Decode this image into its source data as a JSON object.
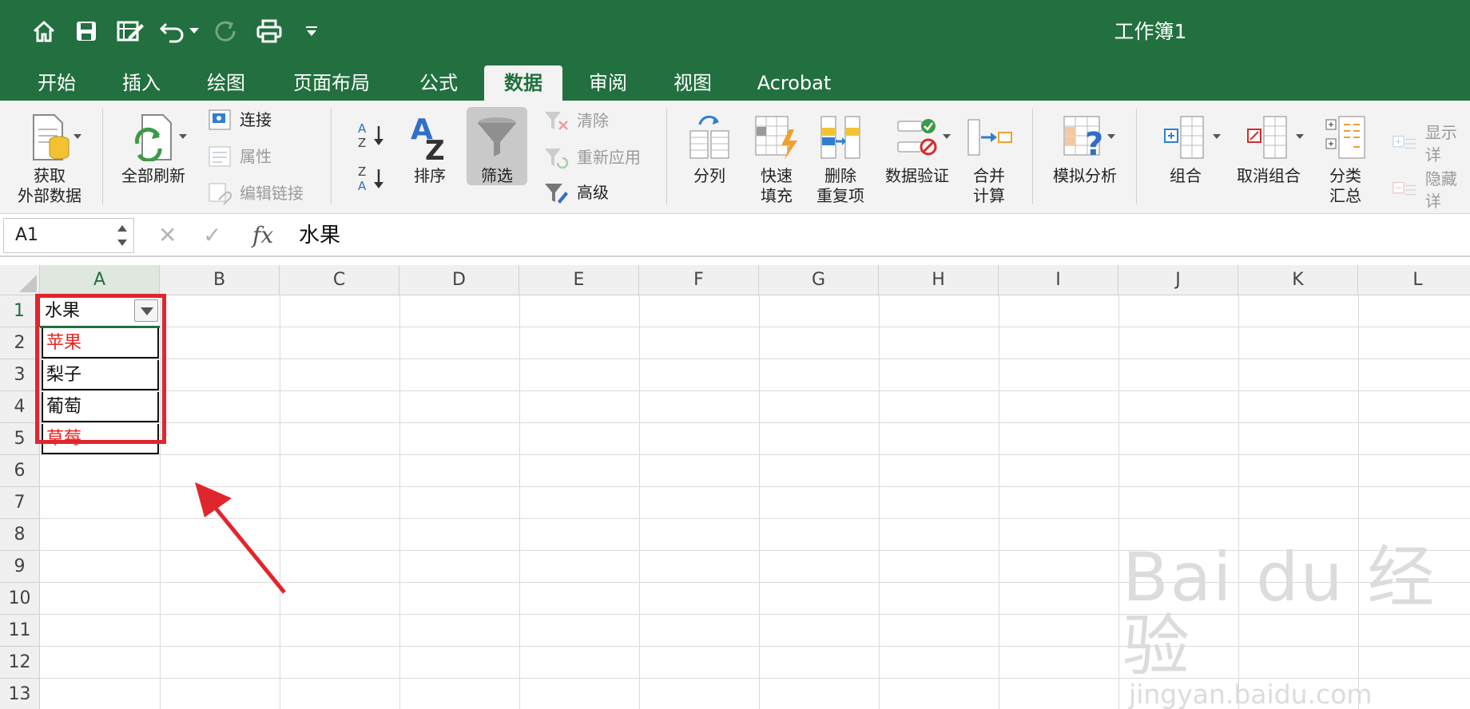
{
  "window": {
    "title": "工作簿1"
  },
  "tabs": [
    {
      "label": "开始"
    },
    {
      "label": "插入"
    },
    {
      "label": "绘图"
    },
    {
      "label": "页面布局"
    },
    {
      "label": "公式"
    },
    {
      "label": "数据"
    },
    {
      "label": "审阅"
    },
    {
      "label": "视图"
    },
    {
      "label": "Acrobat"
    }
  ],
  "active_tab": "数据",
  "ribbon": {
    "get_external_line1": "获取",
    "get_external_line2": "外部数据",
    "refresh_all": "全部刷新",
    "connections": "连接",
    "properties": "属性",
    "edit_links": "编辑链接",
    "sort": "排序",
    "filter": "筛选",
    "clear": "清除",
    "reapply": "重新应用",
    "advanced": "高级",
    "text_to_columns": "分列",
    "flash_fill_line1": "快速",
    "flash_fill_line2": "填充",
    "remove_dup_line1": "删除",
    "remove_dup_line2": "重复项",
    "data_validation": "数据验证",
    "consolidate_line1": "合并",
    "consolidate_line2": "计算",
    "what_if": "模拟分析",
    "group": "组合",
    "ungroup": "取消组合",
    "subtotal_line1": "分类",
    "subtotal_line2": "汇总",
    "show_detail": "显示详",
    "hide_detail": "隐藏详"
  },
  "formula_bar": {
    "name_box": "A1",
    "fx": "fx",
    "value": "水果"
  },
  "sheet": {
    "columns": [
      "A",
      "B",
      "C",
      "D",
      "E",
      "F",
      "G",
      "H",
      "I",
      "J",
      "K",
      "L"
    ],
    "rows": [
      "1",
      "2",
      "3",
      "4",
      "5",
      "6",
      "7",
      "8",
      "9",
      "10",
      "11",
      "12",
      "13"
    ],
    "cells_a": [
      "水果",
      "苹果",
      "梨子",
      "葡萄",
      "草莓"
    ],
    "highlight_color": "#e8231f",
    "accent_color": "#22703f"
  },
  "watermark": {
    "line1": "Bai du 经验",
    "line2": "jingyan.baidu.com"
  }
}
